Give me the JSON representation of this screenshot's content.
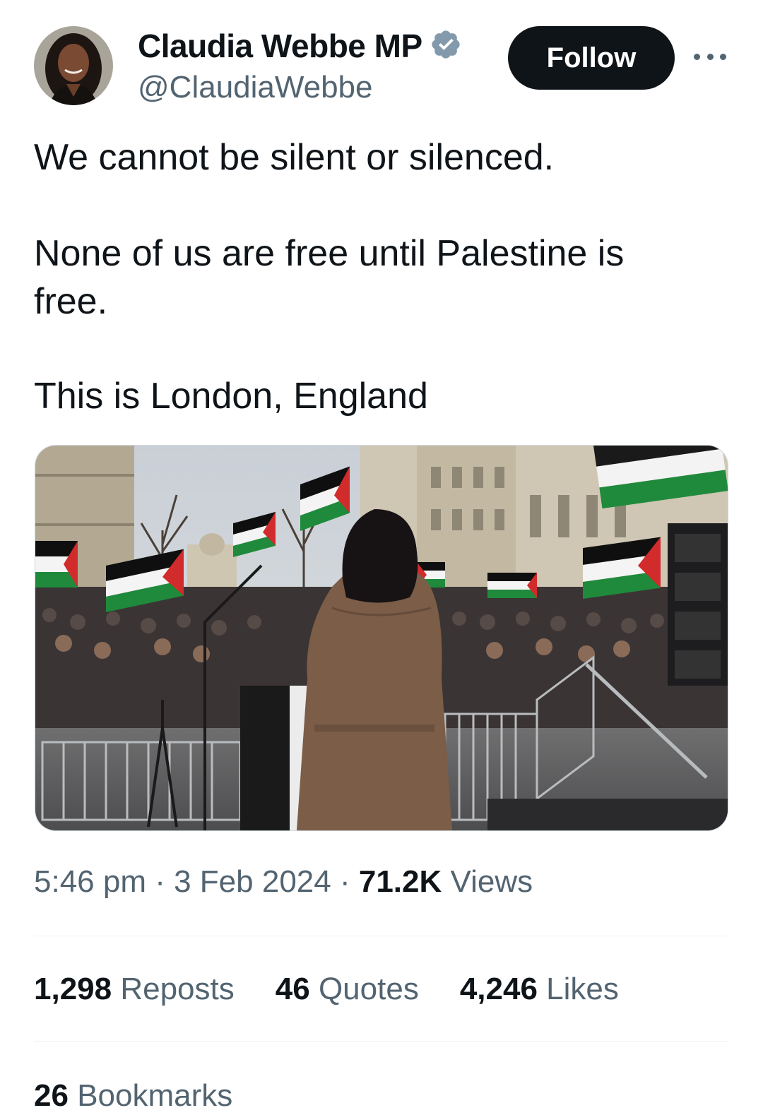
{
  "author": {
    "display_name": "Claudia Webbe MP",
    "handle": "@ClaudiaWebbe",
    "verified": true,
    "verified_badge_color": "#829aab",
    "avatar": "profile-photo"
  },
  "follow_label": "Follow",
  "more_icon": "more-horizontal-icon",
  "tweet": {
    "line1": "We cannot be silent or silenced.",
    "line2": "None of us are free until Palestine is",
    "line3": "free.",
    "line4": "This is London, England"
  },
  "media": {
    "description": "rally-photo"
  },
  "meta": {
    "time": "5:46 pm",
    "separator": "·",
    "date": "3 Feb 2024",
    "views_count": "71.2K",
    "views_label": "Views"
  },
  "stats": {
    "reposts_count": "1,298",
    "reposts_label": "Reposts",
    "quotes_count": "46",
    "quotes_label": "Quotes",
    "likes_count": "4,246",
    "likes_label": "Likes",
    "bookmarks_count": "26",
    "bookmarks_label": "Bookmarks"
  },
  "colors": {
    "text_primary": "#0f1419",
    "text_secondary": "#536471",
    "follow_bg": "#0f1419",
    "divider": "#eff3f4"
  }
}
